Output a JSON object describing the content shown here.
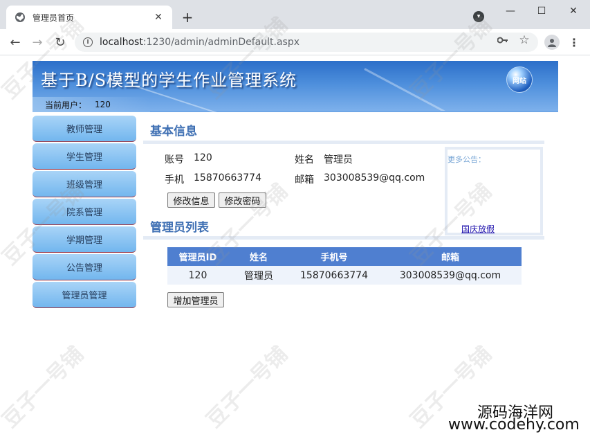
{
  "browser": {
    "tab_title": "管理员首页",
    "url_host": "localhost",
    "url_path": ":1230/admin/adminDefault.aspx"
  },
  "header": {
    "title": "基于B/S模型的学生作业管理系统",
    "current_user_label": "当前用户：",
    "current_user_value": "120",
    "globe_text": "网站"
  },
  "sidebar": {
    "items": [
      {
        "label": "教师管理"
      },
      {
        "label": "学生管理"
      },
      {
        "label": "班级管理"
      },
      {
        "label": "院系管理"
      },
      {
        "label": "学期管理"
      },
      {
        "label": "公告管理"
      },
      {
        "label": "管理员管理"
      }
    ]
  },
  "basic_info": {
    "title": "基本信息",
    "account_label": "账号",
    "account_value": "120",
    "name_label": "姓名",
    "name_value": "管理员",
    "phone_label": "手机",
    "phone_value": "15870663774",
    "email_label": "邮箱",
    "email_value": "303008539@qq.com",
    "edit_info_button": "修改信息",
    "edit_password_button": "修改密码"
  },
  "notice": {
    "heading": "更多公告：",
    "link": "国庆放假"
  },
  "admin_list": {
    "title": "管理员列表",
    "columns": [
      "管理员ID",
      "姓名",
      "手机号",
      "邮箱"
    ],
    "rows": [
      [
        "120",
        "管理员",
        "15870663774",
        "303008539@qq.com"
      ]
    ],
    "add_button": "增加管理员"
  },
  "watermark": {
    "text": "豆子一号铺",
    "brand_line1": "源码海洋网",
    "brand_line2": "www.codehy.com"
  }
}
